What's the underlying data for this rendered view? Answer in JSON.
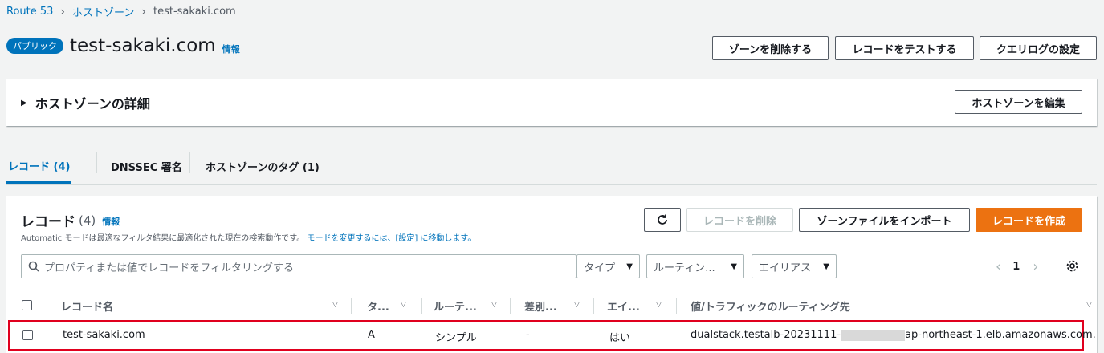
{
  "breadcrumb": {
    "items": [
      "Route 53",
      "ホストゾーン",
      "test-sakaki.com"
    ]
  },
  "header": {
    "badge": "パブリック",
    "title": "test-sakaki.com",
    "info": "情報",
    "delete_zone": "ゾーンを削除する",
    "test_record": "レコードをテストする",
    "query_log": "クエリログの設定"
  },
  "details": {
    "title": "ホストゾーンの詳細",
    "edit": "ホストゾーンを編集"
  },
  "tabs": [
    {
      "label": "レコード (4)",
      "active": true
    },
    {
      "label": "DNSSEC 署名",
      "active": false
    },
    {
      "label": "ホストゾーンのタグ (1)",
      "active": false
    }
  ],
  "records": {
    "title": "レコード",
    "count": "(4)",
    "info": "情報",
    "description": "Automatic モードは最適なフィルタ結果に最適化された現在の検索動作です。",
    "description_link": "モードを変更するには、[設定] に移動します。",
    "delete": "レコードを削除",
    "import": "ゾーンファイルをインポート",
    "create": "レコードを作成",
    "search_placeholder": "プロパティまたは値でレコードをフィルタリングする",
    "filters": [
      "タイプ",
      "ルーティン...",
      "エイリアス"
    ],
    "page": "1",
    "columns": [
      "レコード名",
      "タ...",
      "ルーテ...",
      "差別...",
      "エイ...",
      "値/トラフィックのルーティング先"
    ],
    "rows": [
      {
        "name": "test-sakaki.com",
        "type": "A",
        "routing": "シンプル",
        "differentiator": "-",
        "alias": "はい",
        "value_prefix": "dualstack.testalb-20231111-",
        "value_suffix": "ap-northeast-1.elb.amazonaws.com."
      }
    ]
  },
  "colors": {
    "accent": "#0073bb",
    "primary": "#ec7211",
    "highlight": "#e0001e"
  }
}
